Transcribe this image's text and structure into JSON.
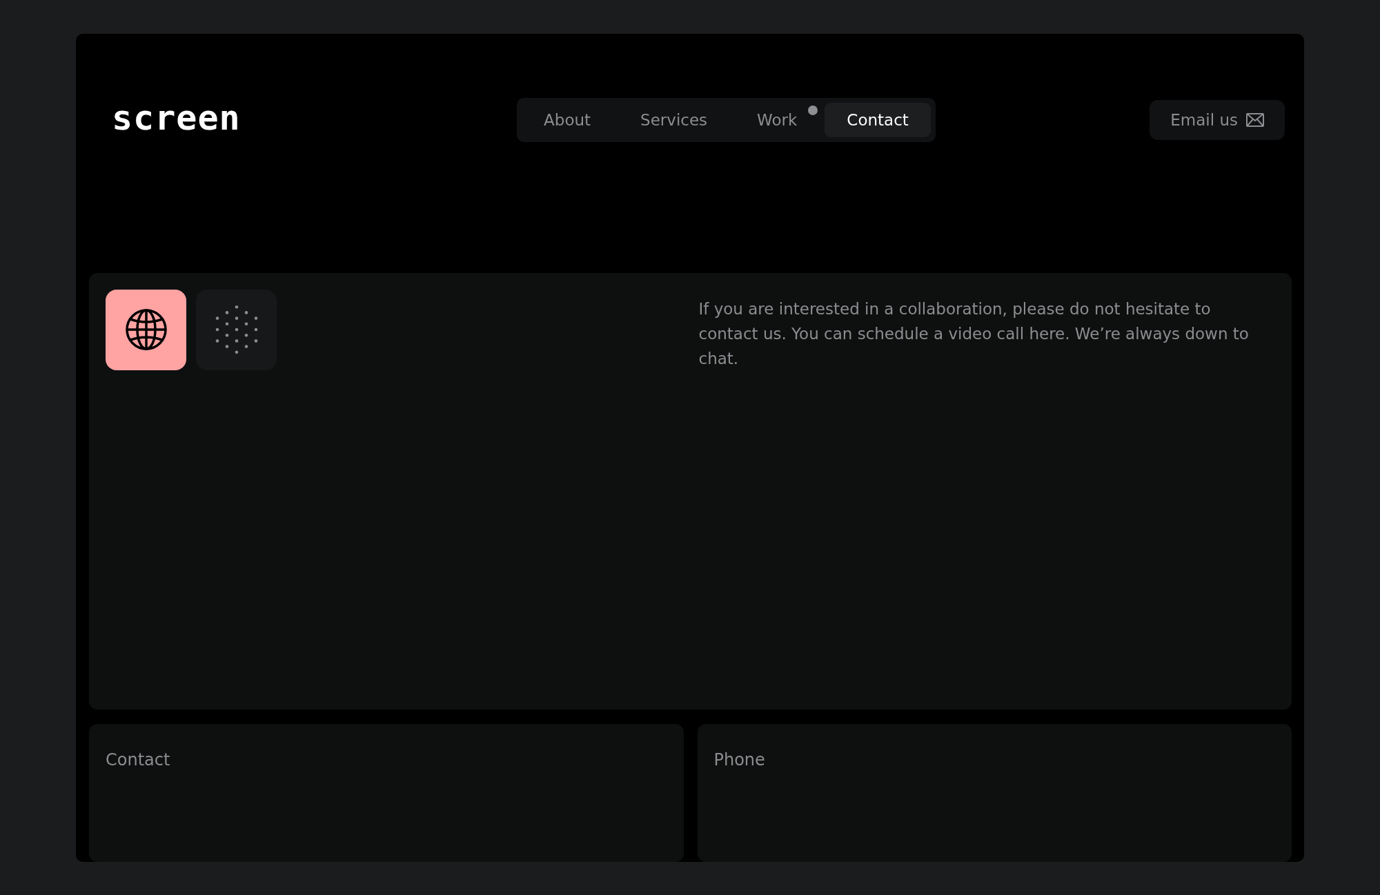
{
  "logo": {
    "text": "screen"
  },
  "nav": {
    "items": [
      {
        "label": "About",
        "selected": false,
        "dot": false
      },
      {
        "label": "Services",
        "selected": false,
        "dot": false
      },
      {
        "label": "Work",
        "selected": false,
        "dot": true
      },
      {
        "label": "Contact",
        "selected": true,
        "dot": false
      }
    ]
  },
  "email_button": {
    "label": "Email us"
  },
  "intro": {
    "text": "If you are interested in a collaboration, please do not hesitate to contact us. You can schedule a video call here. We’re always down to chat."
  },
  "cards": [
    {
      "title": "Contact"
    },
    {
      "title": "Phone"
    }
  ]
}
